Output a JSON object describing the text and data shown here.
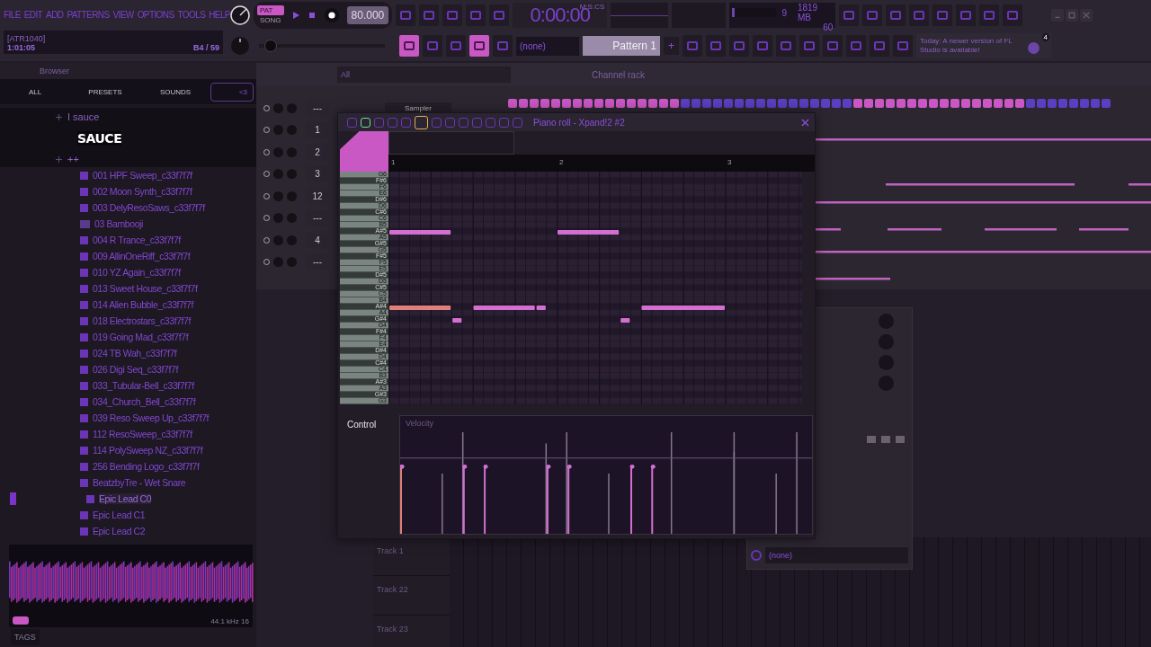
{
  "menu": [
    "FILE",
    "EDIT",
    "ADD",
    "PATTERNS",
    "VIEW",
    "OPTIONS",
    "TOOLS",
    "HELP"
  ],
  "hint_panel": {
    "code": "[ATR1040]",
    "time": "1:01:05",
    "note": "B4 / 59"
  },
  "transport": {
    "modes": [
      {
        "label": "PAT",
        "selected": true
      },
      {
        "label": "SONG",
        "selected": false
      }
    ],
    "tempo": "80.000",
    "time": "0:00:00",
    "time_label": "M:S:CS"
  },
  "master_pitch": {
    "level": 0.04
  },
  "performance": {
    "cpu_meter": {
      "level": 0.05
    },
    "cpu": "9",
    "memory": "1819 MB",
    "polyphony": "60"
  },
  "toolbar": {
    "toggles": [
      {
        "on": true
      },
      {
        "on": false
      },
      {
        "on": false
      },
      {
        "on": true
      },
      {
        "on": false
      }
    ],
    "snap": "(none)",
    "pattern": "Pattern 1",
    "add": "+"
  },
  "news": {
    "text": "Today: A newer version of FL Studio is available!",
    "badge": "4"
  },
  "browser": {
    "title": "Browser",
    "tabs": [
      {
        "label": "ALL",
        "selected": false
      },
      {
        "label": "PRESETS",
        "selected": false
      },
      {
        "label": "SOUNDS",
        "selected": false
      },
      {
        "label": "<3",
        "selected": true
      }
    ],
    "tree": [
      {
        "label": "I sauce",
        "kind": "folder"
      },
      {
        "label": "SAUCE",
        "kind": "banner"
      },
      {
        "label": "++",
        "kind": "folder"
      },
      {
        "label": "001 HPF Sweep_c33f7f7f",
        "kind": "preset",
        "selected": false
      },
      {
        "label": "002 Moon Synth_c33f7f7f",
        "kind": "preset",
        "selected": false
      },
      {
        "label": "003 DelyResoSaws_c33f7f7f",
        "kind": "preset",
        "selected": false
      },
      {
        "label": "03 Bambooji",
        "kind": "audio",
        "selected": false
      },
      {
        "label": "004 R Trance_c33f7f7f",
        "kind": "preset",
        "selected": false
      },
      {
        "label": "009 AllinOneRiff_c33f7f7f",
        "kind": "preset",
        "selected": false
      },
      {
        "label": "010 YZ Again_c33f7f7f",
        "kind": "preset",
        "selected": false
      },
      {
        "label": "013 Sweet House_c33f7f7f",
        "kind": "preset",
        "selected": false
      },
      {
        "label": "014 Alien Bubble_c33f7f7f",
        "kind": "preset",
        "selected": false
      },
      {
        "label": "018 Electrostars_c33f7f7f",
        "kind": "preset",
        "selected": false
      },
      {
        "label": "019 Going Mad_c33f7f7f",
        "kind": "preset",
        "selected": false
      },
      {
        "label": "024 TB Wah_c33f7f7f",
        "kind": "preset",
        "selected": false
      },
      {
        "label": "026 Digi Seq_c33f7f7f",
        "kind": "preset",
        "selected": false
      },
      {
        "label": "033_Tubular-Bell_c33f7f7f",
        "kind": "preset",
        "selected": false
      },
      {
        "label": "034_Church_Bell_c33f7f7f",
        "kind": "preset",
        "selected": false
      },
      {
        "label": "039 Reso Sweep Up_c33f7f7f",
        "kind": "preset",
        "selected": false
      },
      {
        "label": "112 ResoSweep_c33f7f7f",
        "kind": "preset",
        "selected": false
      },
      {
        "label": "114 PolySweep NZ_c33f7f7f",
        "kind": "preset",
        "selected": false
      },
      {
        "label": "256 Bending Logo_c33f7f7f",
        "kind": "preset",
        "selected": false
      },
      {
        "label": "BeatzbyTre - Wet Snare",
        "kind": "preset",
        "selected": false
      },
      {
        "label": "Epic Lead C0",
        "kind": "preset",
        "selected": true
      },
      {
        "label": "Epic Lead C1",
        "kind": "preset",
        "selected": false
      },
      {
        "label": "Epic Lead C2",
        "kind": "preset",
        "selected": false
      }
    ],
    "sample_info": "44.1 kHz 16",
    "tags": "TAGS"
  },
  "channel_rack": {
    "filter": "All",
    "title": "Channel rack",
    "channels": [
      {
        "target": "---",
        "name": "Sampler"
      },
      {
        "target": "1"
      },
      {
        "target": "2"
      },
      {
        "target": "3"
      },
      {
        "target": "12"
      },
      {
        "target": "---"
      },
      {
        "target": "4"
      },
      {
        "target": "---"
      }
    ]
  },
  "piano_roll": {
    "title": "Piano roll - Xpand!2 #2",
    "bars": [
      "1",
      "2",
      "3"
    ],
    "keys": [
      "G6",
      "F#6",
      "F6",
      "E6",
      "D#6",
      "D6",
      "C#6",
      "C6",
      "B5",
      "A#5",
      "A5",
      "G#5",
      "G5",
      "F#5",
      "F5",
      "E5",
      "D#5",
      "D5",
      "C#5",
      "C5",
      "B4",
      "A#4",
      "A4",
      "G#4",
      "G4",
      "F#4",
      "F4",
      "E4",
      "D#4",
      "D4",
      "C#4",
      "C4",
      "B3",
      "A#3",
      "A3",
      "G#3",
      "G3"
    ],
    "control": "Control",
    "event": "Velocity"
  },
  "channel_settings": {
    "output": "(none)"
  },
  "playlist": {
    "tracks": [
      "Track 1",
      "Track 22",
      "Track 23"
    ]
  }
}
